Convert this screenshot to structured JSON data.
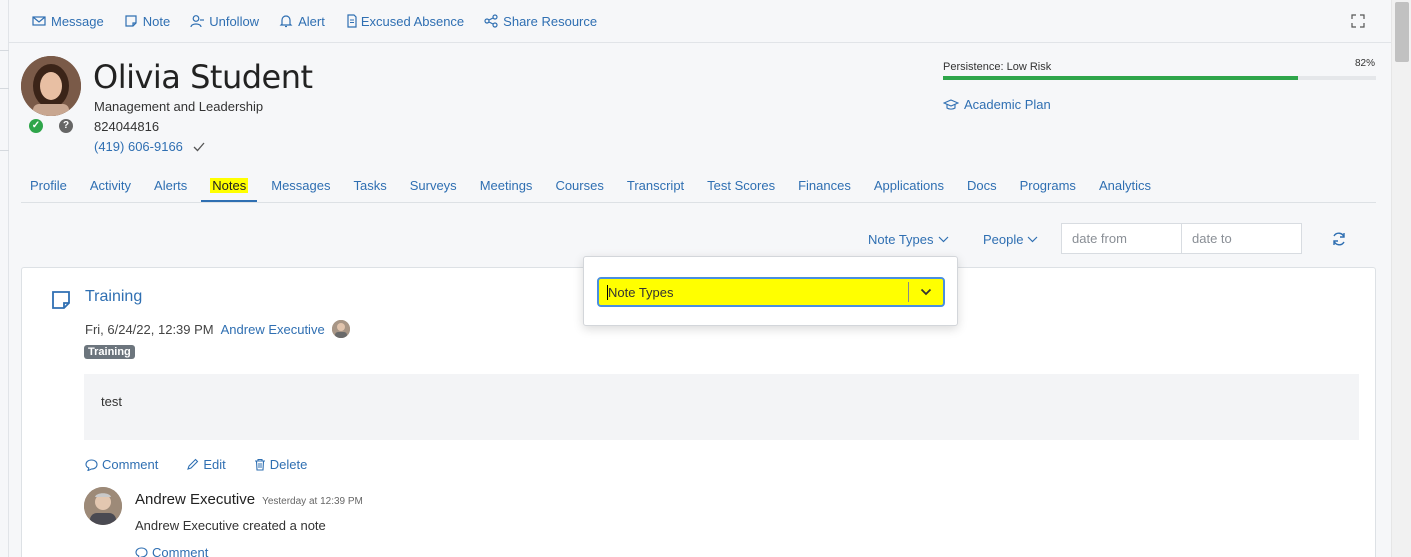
{
  "actions": {
    "message": "Message",
    "note": "Note",
    "unfollow": "Unfollow",
    "alert": "Alert",
    "excused_absence": "Excused Absence",
    "share_resource": "Share Resource"
  },
  "student": {
    "name": "Olivia Student",
    "program": "Management and Leadership",
    "id": "824044816",
    "phone": "(419) 606-9166"
  },
  "persistence": {
    "label": "Persistence: Low Risk",
    "percent_label": "82%",
    "percent": 82,
    "color": "#2ea54a"
  },
  "academic_plan": "Academic Plan",
  "tabs": [
    {
      "label": "Profile"
    },
    {
      "label": "Activity"
    },
    {
      "label": "Alerts"
    },
    {
      "label": "Notes",
      "active": true
    },
    {
      "label": "Messages"
    },
    {
      "label": "Tasks"
    },
    {
      "label": "Surveys"
    },
    {
      "label": "Meetings"
    },
    {
      "label": "Courses"
    },
    {
      "label": "Transcript"
    },
    {
      "label": "Test Scores"
    },
    {
      "label": "Finances"
    },
    {
      "label": "Applications"
    },
    {
      "label": "Docs"
    },
    {
      "label": "Programs"
    },
    {
      "label": "Analytics"
    }
  ],
  "filters": {
    "note_types": "Note Types",
    "people": "People",
    "date_from_placeholder": "date from",
    "date_to_placeholder": "date to"
  },
  "note": {
    "title": "Training",
    "timestamp": "Fri, 6/24/22, 12:39 PM",
    "author": "Andrew Executive",
    "badge": "Training",
    "body": "test",
    "comment_label": "Comment",
    "edit_label": "Edit",
    "delete_label": "Delete"
  },
  "comment": {
    "author": "Andrew Executive",
    "time": "Yesterday at 12:39 PM",
    "text": "Andrew Executive created a note",
    "comment_label": "Comment"
  },
  "popover": {
    "select_value": "Note Types",
    "highlight_color": "#ffff00"
  }
}
